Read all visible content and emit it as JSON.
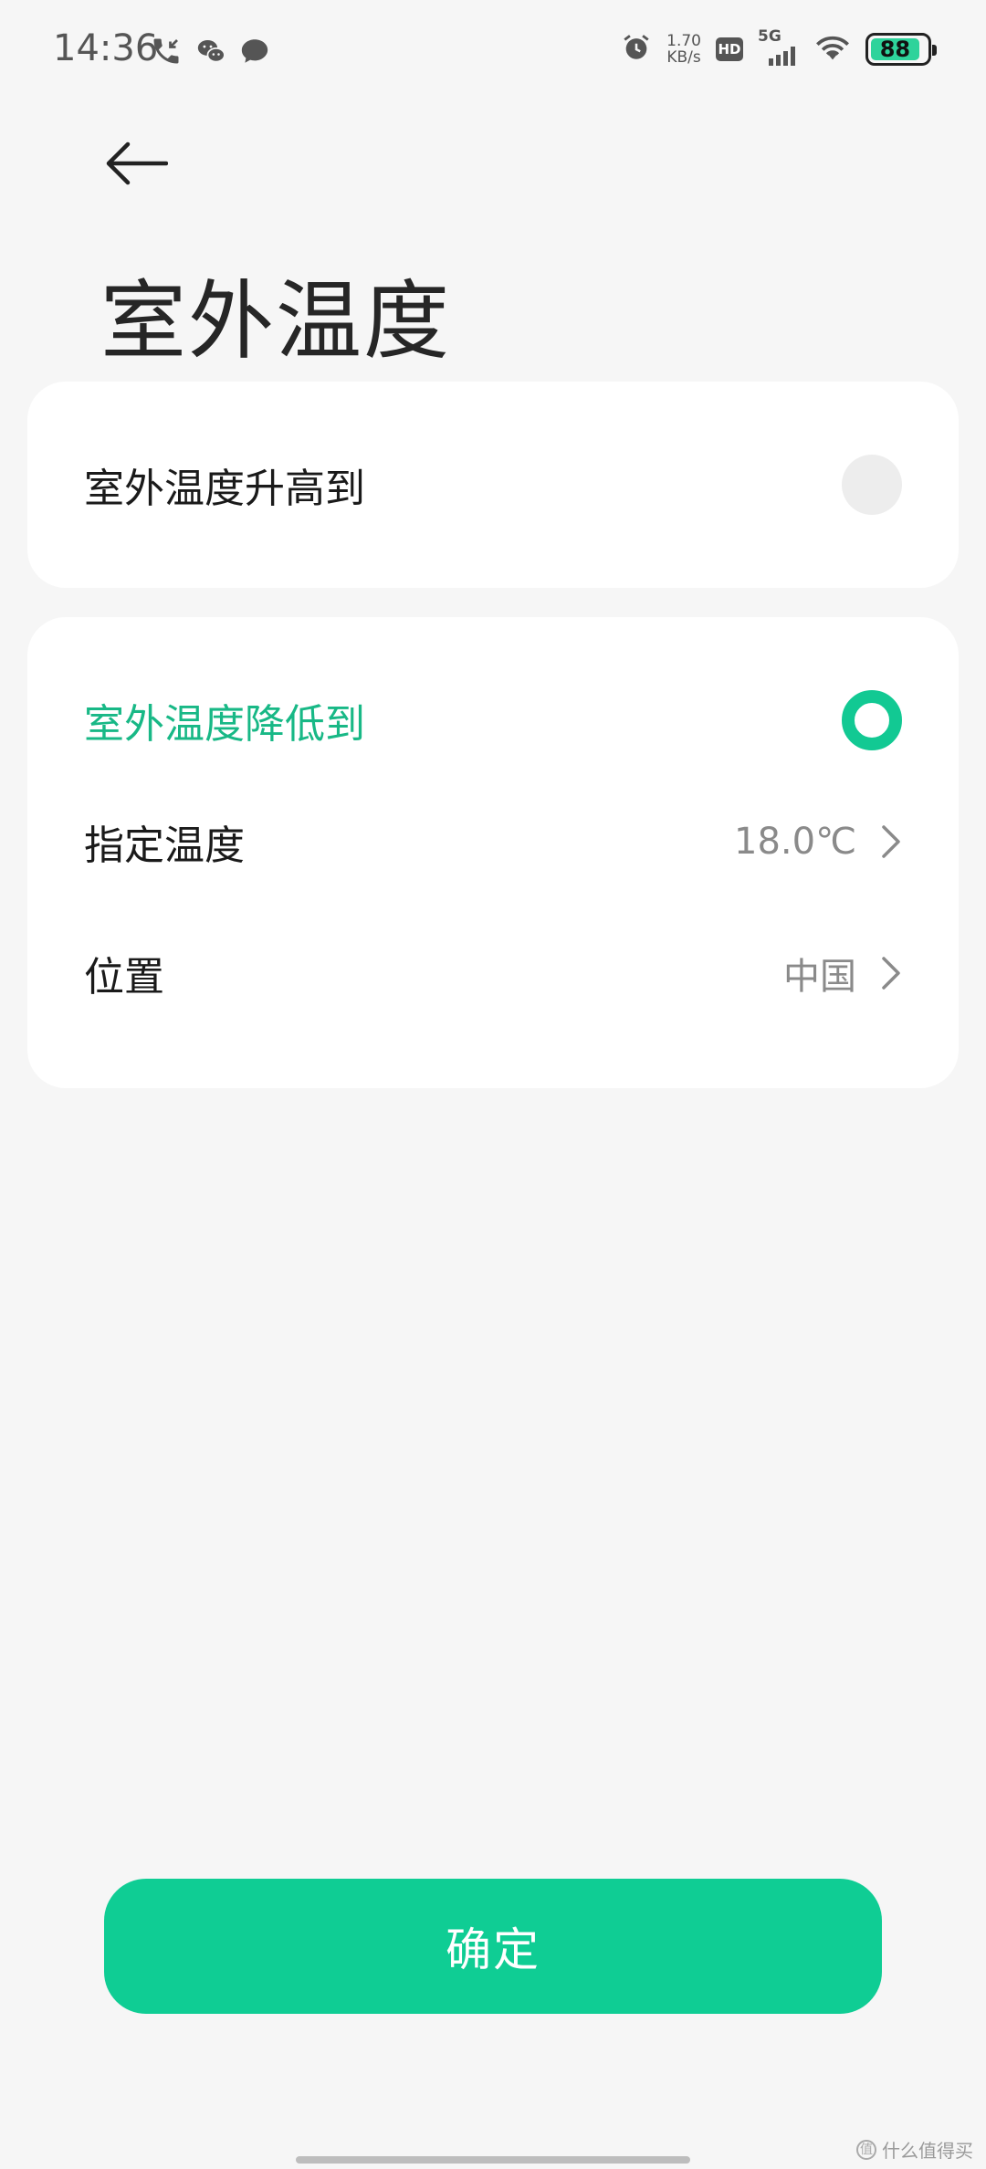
{
  "status_bar": {
    "time": "14:36",
    "net_speed_value": "1.70",
    "net_speed_unit": "KB/s",
    "hd_label": "HD",
    "network_label": "5G",
    "battery_level": "88"
  },
  "header": {
    "title": "室外温度"
  },
  "options": {
    "rise_label": "室外温度升高到",
    "fall_label": "室外温度降低到",
    "selected": "fall"
  },
  "settings": {
    "temperature_label": "指定温度",
    "temperature_value": "18.0℃",
    "location_label": "位置",
    "location_value": "中国"
  },
  "footer": {
    "confirm_label": "确定"
  },
  "watermark": {
    "text": "什么值得买",
    "icon_text": "值"
  },
  "colors": {
    "accent": "#0fcd94",
    "active_text": "#18b886",
    "background": "#f6f6f6"
  }
}
